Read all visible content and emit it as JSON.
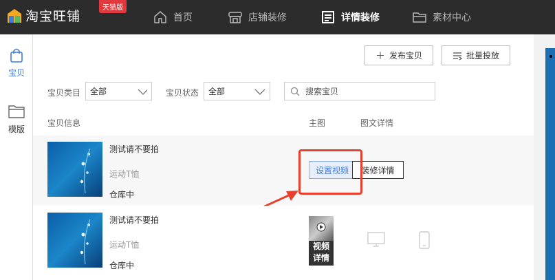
{
  "app": {
    "name": "淘宝旺铺",
    "badge": "天猫版"
  },
  "nav": {
    "items": [
      {
        "label": "首页",
        "icon": "home-icon"
      },
      {
        "label": "店铺装修",
        "icon": "store-icon"
      },
      {
        "label": "详情装修",
        "icon": "document-icon",
        "active": true
      },
      {
        "label": "素材中心",
        "icon": "folder-icon"
      }
    ]
  },
  "sidebar": {
    "items": [
      {
        "label": "宝贝",
        "icon": "bag-icon",
        "active": true
      },
      {
        "label": "模版",
        "icon": "folder-icon"
      }
    ]
  },
  "toolbar": {
    "publish_label": "发布宝贝",
    "batch_label": "批量投放"
  },
  "filters": {
    "category_label": "宝贝类目",
    "category_value": "全部",
    "status_label": "宝贝状态",
    "status_value": "全部",
    "search_placeholder": "搜索宝贝"
  },
  "columns": {
    "info": "宝贝信息",
    "main_image": "主图",
    "detail": "图文详情"
  },
  "products": [
    {
      "title": "测试请不要拍",
      "subtitle": "运动T恤",
      "stock": "仓库中",
      "set_video_label": "设置视频",
      "decorate_label": "装修详情"
    },
    {
      "title": "测试请不要拍",
      "subtitle": "运动T恤",
      "stock": "仓库中",
      "video_label_line1": "视频",
      "video_label_line2": "详情"
    }
  ],
  "colors": {
    "accent": "#3f7ce0",
    "highlight": "#e8402c",
    "topbar": "#2c2c2c"
  }
}
